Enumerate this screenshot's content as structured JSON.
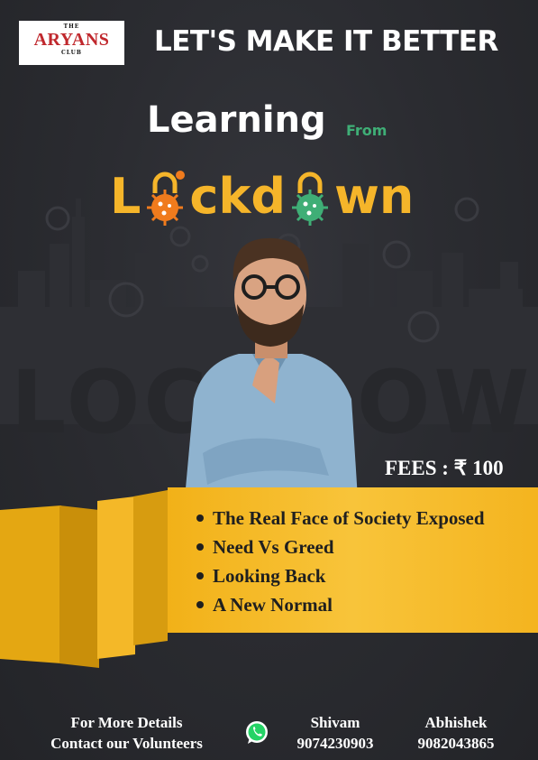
{
  "logo": {
    "top": "THE",
    "name": "ARYANS",
    "bottom": "CLUB"
  },
  "tagline": "LET'S MAKE IT BETTER",
  "headline": {
    "learning": "Learning",
    "from": "From",
    "lockdown_part1": "L",
    "lockdown_part2": "ckd",
    "lockdown_part3": "wn"
  },
  "background_word": "LOCKDOWN",
  "fees": "FEES : ₹ 100",
  "topics": [
    "The Real Face of Society Exposed",
    "Need Vs Greed",
    "Looking Back",
    "A New Normal"
  ],
  "footer": {
    "line1": "For More Details",
    "line2": "Contact our Volunteers",
    "contacts": [
      {
        "name": "Shivam",
        "phone": "9074230903"
      },
      {
        "name": "Abhishek",
        "phone": "9082043865"
      }
    ]
  },
  "colors": {
    "background": "#2b2c31",
    "accent_yellow": "#f5b52a",
    "accent_green": "#3fae76",
    "accent_orange": "#f07b1d",
    "logo_red": "#c0282d"
  },
  "icons": [
    "whatsapp-icon",
    "padlock-virus-icon",
    "man-thinking-photo"
  ]
}
